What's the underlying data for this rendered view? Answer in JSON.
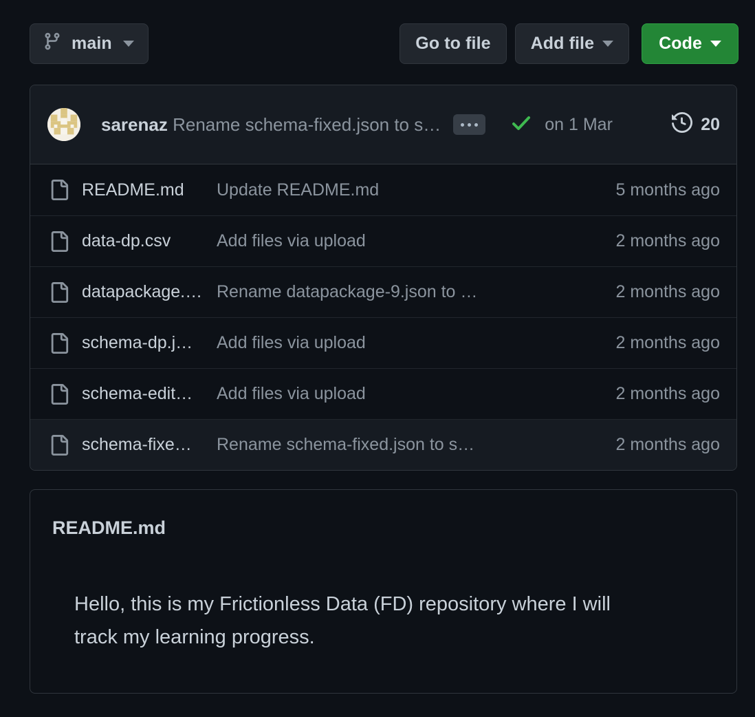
{
  "toolbar": {
    "branch": {
      "icon": "git-branch-icon",
      "label": "main",
      "caret": "chevron-down-icon"
    },
    "go_to_file": {
      "label": "Go to file"
    },
    "add_file": {
      "label": "Add file",
      "caret": "chevron-down-icon"
    },
    "code": {
      "label": "Code",
      "caret": "chevron-down-icon",
      "color": "#238636"
    }
  },
  "latest_commit": {
    "avatar": "user-identicon-avatar",
    "author": "sarenaz",
    "message": "Rename schema-fixed.json to s…",
    "ellipsis_label": "…",
    "status_icon": "check-icon",
    "status_color": "#3fb950",
    "date": "on 1 Mar",
    "history_icon": "history-icon",
    "commit_count": "20"
  },
  "files": [
    {
      "icon": "file-icon",
      "name": "README.md",
      "message": "Update README.md",
      "age": "5 months ago",
      "hover": false
    },
    {
      "icon": "file-icon",
      "name": "data-dp.csv",
      "message": "Add files via upload",
      "age": "2 months ago",
      "hover": false
    },
    {
      "icon": "file-icon",
      "name": "datapackage.…",
      "message": "Rename datapackage-9.json to …",
      "age": "2 months ago",
      "hover": false
    },
    {
      "icon": "file-icon",
      "name": "schema-dp.j…",
      "message": "Add files via upload",
      "age": "2 months ago",
      "hover": false
    },
    {
      "icon": "file-icon",
      "name": "schema-edit…",
      "message": "Add files via upload",
      "age": "2 months ago",
      "hover": false
    },
    {
      "icon": "file-icon",
      "name": "schema-fixe…",
      "message": "Rename schema-fixed.json to s…",
      "age": "2 months ago",
      "hover": true
    }
  ],
  "readme": {
    "title": "README.md",
    "body": "Hello, this is my Frictionless Data (FD) repository where I will track my learning progress."
  },
  "colors": {
    "page_background": "#0d1117",
    "card_border": "#30363d",
    "row_divider": "#21262d",
    "header_background": "#161b22",
    "text_primary": "#c9d1d9",
    "text_muted": "#8b949e",
    "accent_green": "#238636",
    "success_green": "#3fb950"
  }
}
